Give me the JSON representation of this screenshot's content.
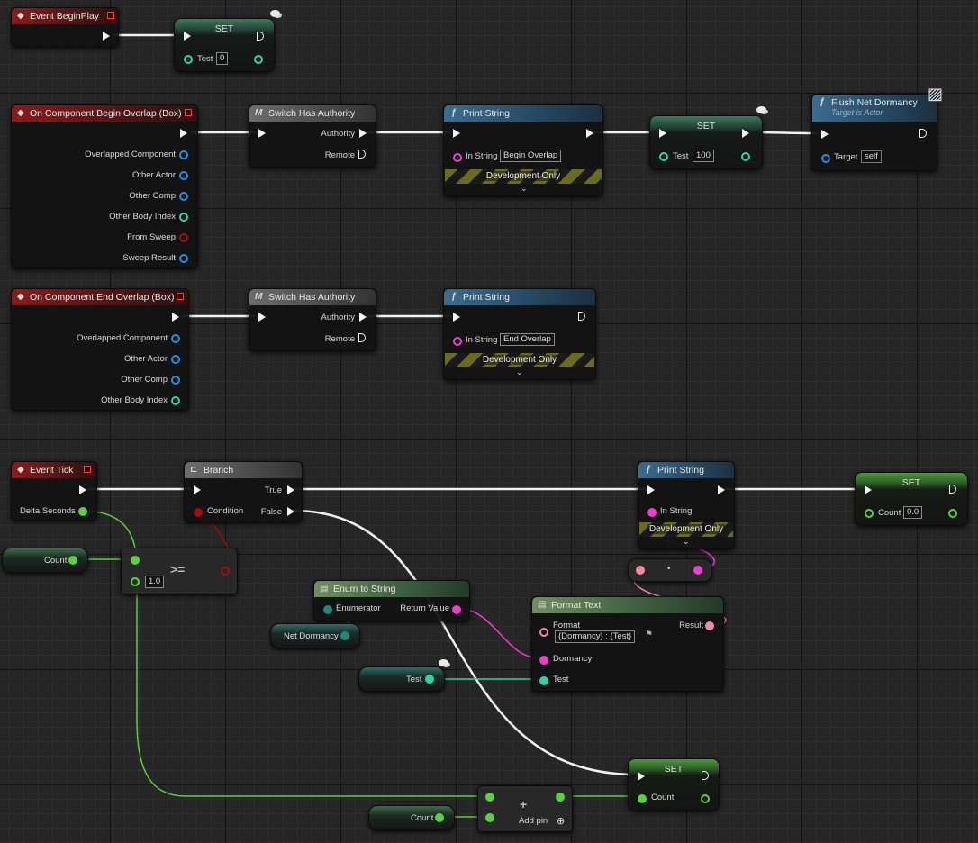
{
  "colors": {
    "exec": "#f2f2f2",
    "object": "#1e90e6",
    "integer": "#2ad6a8",
    "float": "#5ad23a",
    "bool": "#a01010",
    "string": "#f23bd2",
    "text": "#f08aa8",
    "enum": "#1e8a7a"
  },
  "begin_play": {
    "title": "Event BeginPlay",
    "icon": "diamond-event-icon"
  },
  "set_test_1": {
    "title": "SET",
    "pin": "Test",
    "value": "0"
  },
  "begin_overlap": {
    "title": "On Component Begin Overlap (Box)",
    "pins": [
      "Overlapped Component",
      "Other Actor",
      "Other Comp",
      "Other Body Index",
      "From Sweep",
      "Sweep Result"
    ]
  },
  "switch_1": {
    "title": "Switch Has Authority",
    "authority": "Authority",
    "remote": "Remote"
  },
  "print_1": {
    "title": "Print String",
    "in_string": "In String",
    "value": "Begin Overlap",
    "dev": "Development Only"
  },
  "set_test_2": {
    "title": "SET",
    "pin": "Test",
    "value": "100"
  },
  "flush": {
    "title": "Flush Net Dormancy",
    "subtitle": "Target is Actor",
    "target": "Target",
    "value": "self"
  },
  "end_overlap": {
    "title": "On Component End Overlap (Box)",
    "pins": [
      "Overlapped Component",
      "Other Actor",
      "Other Comp",
      "Other Body Index"
    ]
  },
  "switch_2": {
    "title": "Switch Has Authority",
    "authority": "Authority",
    "remote": "Remote"
  },
  "print_2": {
    "title": "Print String",
    "in_string": "In String",
    "value": "End Overlap",
    "dev": "Development Only"
  },
  "event_tick": {
    "title": "Event Tick",
    "delta": "Delta Seconds"
  },
  "branch": {
    "title": "Branch",
    "true": "True",
    "false": "False",
    "condition": "Condition"
  },
  "print_3": {
    "title": "Print String",
    "in_string": "In String",
    "dev": "Development Only"
  },
  "set_count_1": {
    "title": "SET",
    "pin": "Count",
    "value": "0.0"
  },
  "count_get_1": {
    "label": "Count"
  },
  "compare": {
    "op": ">=",
    "value": "1.0"
  },
  "reroute_dot": {
    "label": "•"
  },
  "enum_to_string": {
    "title": "Enum to String",
    "enumerator": "Enumerator",
    "return": "Return Value"
  },
  "net_dormancy": {
    "label": "Net Dormancy"
  },
  "format_text": {
    "title": "Format Text",
    "format": "Format",
    "format_value": "{Dormancy} : {Test}",
    "result": "Result",
    "dormancy": "Dormancy",
    "test": "Test"
  },
  "test_get": {
    "label": "Test"
  },
  "set_count_2": {
    "title": "SET",
    "pin": "Count"
  },
  "add": {
    "op": "+",
    "add_pin": "Add pin"
  },
  "count_get_2": {
    "label": "Count"
  }
}
